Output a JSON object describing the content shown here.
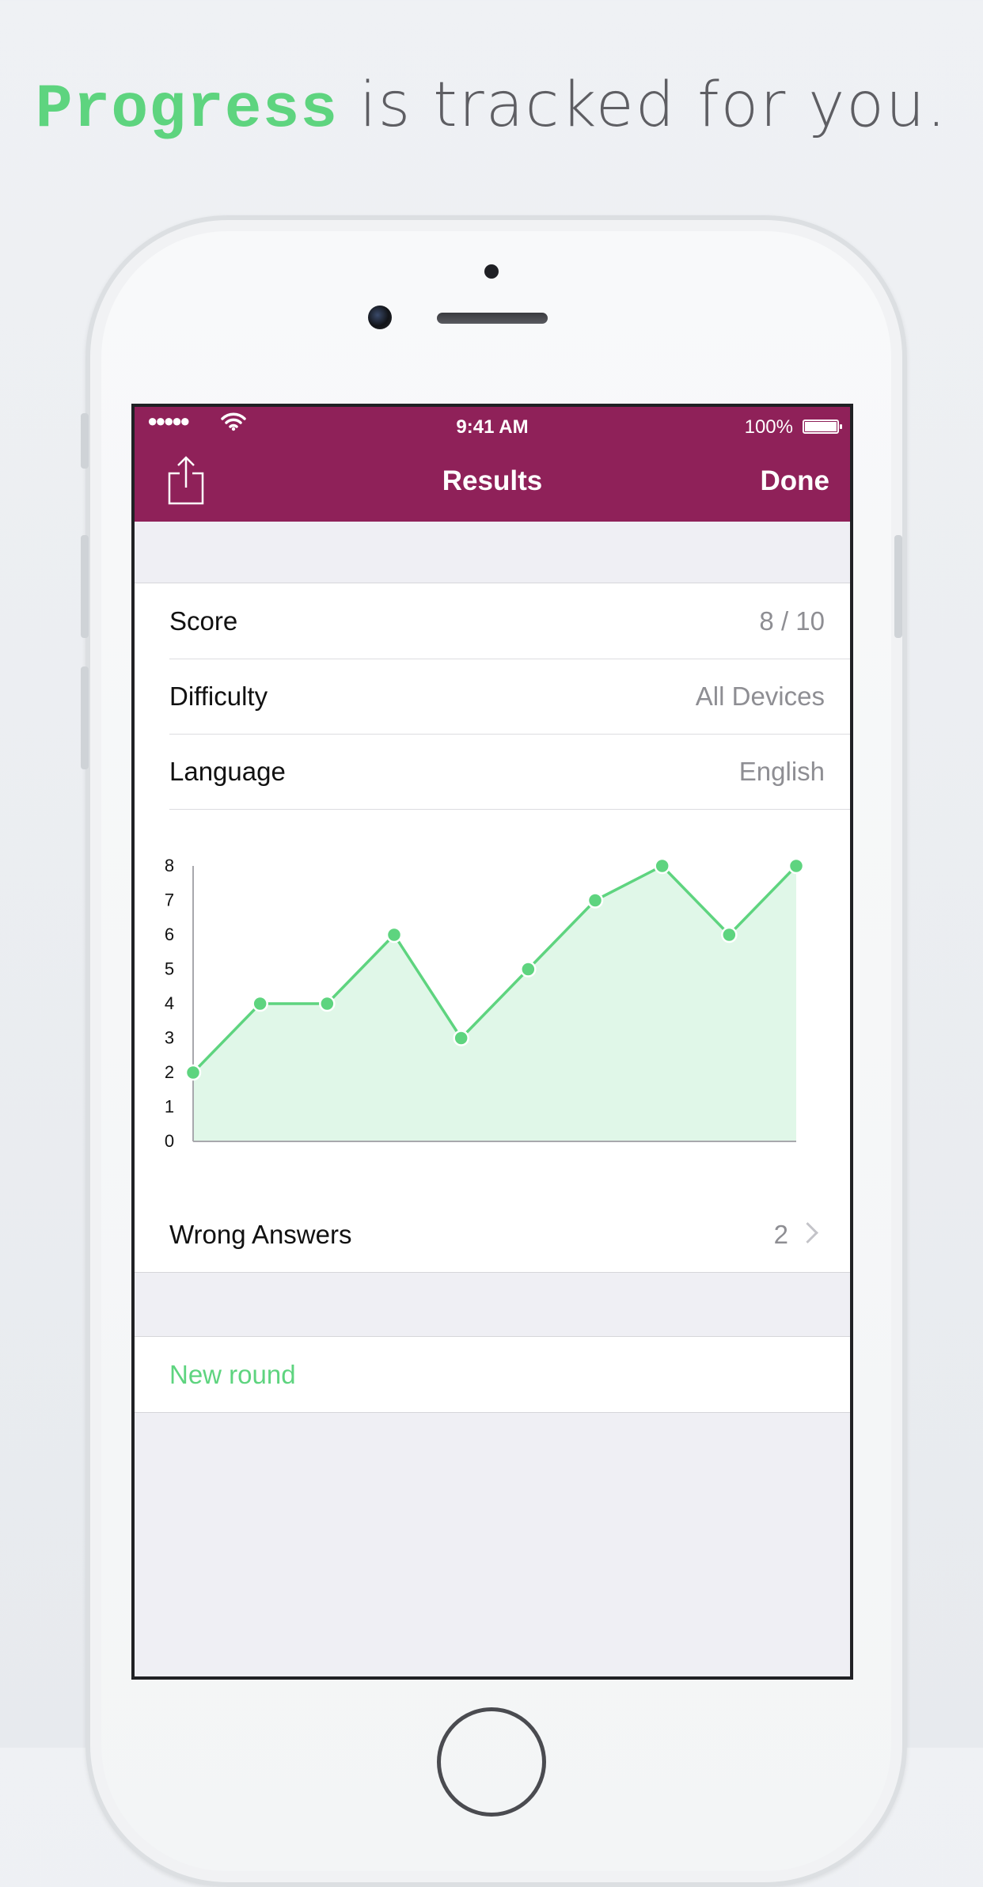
{
  "headline": {
    "keyword": "Progress",
    "rest": " is tracked for you."
  },
  "status_bar": {
    "signal": "●●●●●",
    "time": "9:41 AM",
    "battery": "100%"
  },
  "nav": {
    "title": "Results",
    "done_label": "Done",
    "share_icon": "share-icon"
  },
  "results": {
    "score_label": "Score",
    "score_value": "8 / 10",
    "difficulty_label": "Difficulty",
    "difficulty_value": "All Devices",
    "language_label": "Language",
    "language_value": "English",
    "wrong_label": "Wrong Answers",
    "wrong_value": "2"
  },
  "actions": {
    "new_round": "New round"
  },
  "colors": {
    "nav_bg": "#8f2159",
    "accent": "#5ed47f",
    "area_fill": "#e0f7e8"
  },
  "chart_data": {
    "type": "area",
    "x": [
      1,
      2,
      3,
      4,
      5,
      6,
      7,
      8,
      9,
      10
    ],
    "values": [
      2,
      4,
      4,
      6,
      3,
      5,
      7,
      8,
      6,
      8
    ],
    "ylim": [
      0,
      8
    ],
    "yticks": [
      "0",
      "1",
      "2",
      "3",
      "4",
      "5",
      "6",
      "7",
      "8"
    ],
    "xlabel": "",
    "ylabel": "",
    "title": "",
    "grid": false
  }
}
